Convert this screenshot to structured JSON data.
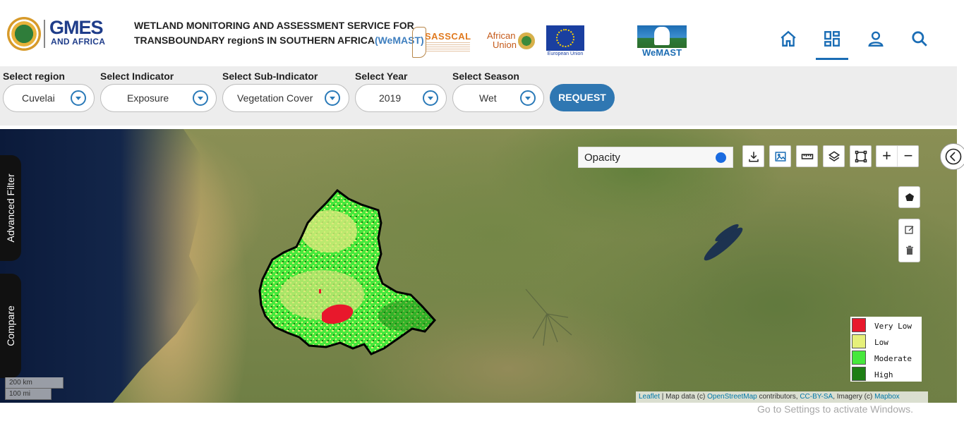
{
  "header": {
    "logo": {
      "line1": "GMES",
      "line2": "AND AFRICA"
    },
    "title_line1": "WETLAND MONITORING AND ASSESSMENT SERVICE FOR",
    "title_line2": "TRANSBOUNDARY regionS IN SOUTHERN AFRICA",
    "title_acronym": "(WeMAST)",
    "partners": {
      "sasscal": "SASSCAL",
      "au_line1": "African",
      "au_line2": "Union",
      "eu": "European Union",
      "wemast": "WeMAST"
    },
    "nav": [
      {
        "icon": "home-icon"
      },
      {
        "icon": "dashboard-icon",
        "active": true
      },
      {
        "icon": "user-icon"
      },
      {
        "icon": "search-icon"
      }
    ],
    "accent_color": "#1a6db5"
  },
  "filters": {
    "region": {
      "label": "Select region",
      "value": "Cuvelai"
    },
    "indicator": {
      "label": "Select Indicator",
      "value": "Exposure"
    },
    "subindicator": {
      "label": "Select Sub-Indicator",
      "value": "Vegetation Cover"
    },
    "year": {
      "label": "Select Year",
      "value": "2019"
    },
    "season": {
      "label": "Select Season",
      "value": "Wet"
    },
    "request_label": "REQUEST"
  },
  "map": {
    "opacity_label": "Opacity",
    "opacity_value": 1.0,
    "toolbar": [
      "download-icon",
      "image-icon",
      "ruler-icon",
      "layers-icon",
      "fullscreen-icon"
    ],
    "zoom_in": "+",
    "zoom_out": "−",
    "draw_tools": [
      "polygon-icon",
      "edit-icon",
      "trash-icon"
    ],
    "side_tabs": {
      "advanced_filter": "Advanced Filter",
      "compare": "Compare"
    },
    "legend": [
      {
        "label": "Very Low",
        "color": "#e8182c"
      },
      {
        "label": "Low",
        "color": "#e6f07a"
      },
      {
        "label": "Moderate",
        "color": "#46e83c"
      },
      {
        "label": "High",
        "color": "#1d7e14"
      }
    ],
    "scale": {
      "km": "200 km",
      "mi": "100 mi"
    },
    "attribution": {
      "leaflet": "Leaflet",
      "sep1": " | Map data (c) ",
      "osm": "OpenStreetMap",
      "mid": " contributors, ",
      "cc": "CC-BY-SA",
      "imagery": ", Imagery (c) ",
      "mapbox": "Mapbox"
    }
  },
  "os_overlay": {
    "activate": "Go to Settings to activate Windows."
  }
}
